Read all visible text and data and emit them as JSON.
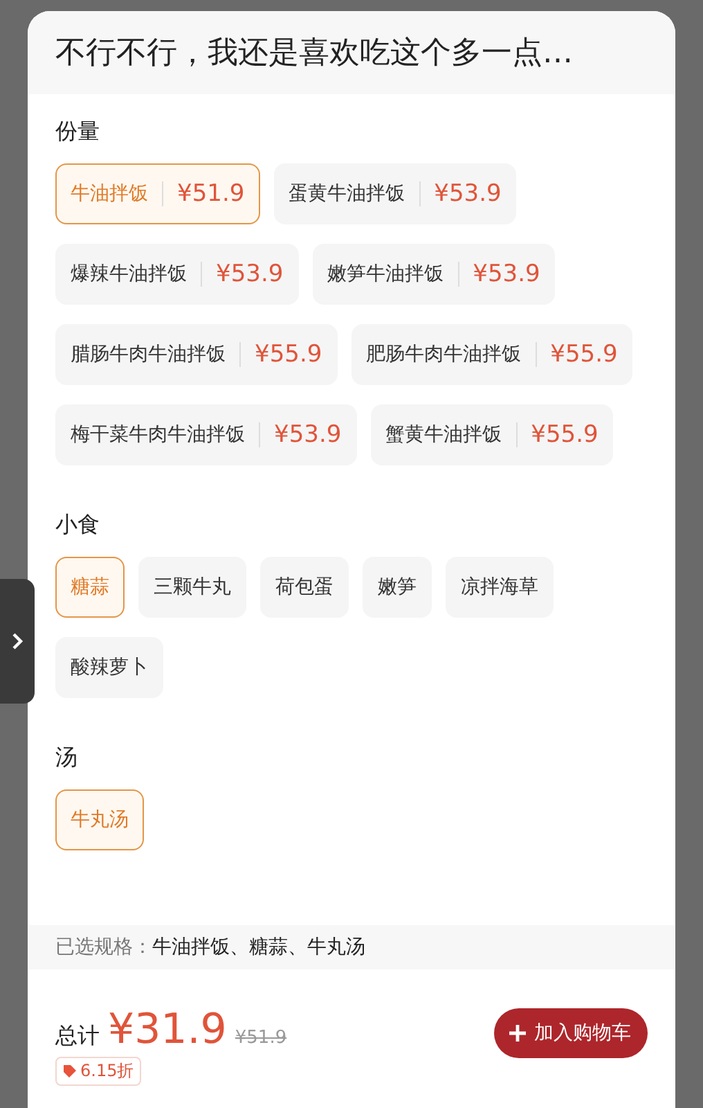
{
  "title": "不行不行，我还是喜欢吃这个多一点…",
  "sections": [
    {
      "label": "份量",
      "options": [
        {
          "label": "牛油拌饭",
          "price": "¥51.9",
          "selected": true
        },
        {
          "label": "蛋黄牛油拌饭",
          "price": "¥53.9",
          "selected": false
        },
        {
          "label": "爆辣牛油拌饭",
          "price": "¥53.9",
          "selected": false
        },
        {
          "label": "嫩笋牛油拌饭",
          "price": "¥53.9",
          "selected": false
        },
        {
          "label": "腊肠牛肉牛油拌饭",
          "price": "¥55.9",
          "selected": false
        },
        {
          "label": "肥肠牛肉牛油拌饭",
          "price": "¥55.9",
          "selected": false
        },
        {
          "label": "梅干菜牛肉牛油拌饭",
          "price": "¥53.9",
          "selected": false
        },
        {
          "label": "蟹黄牛油拌饭",
          "price": "¥55.9",
          "selected": false
        }
      ]
    },
    {
      "label": "小食",
      "options": [
        {
          "label": "糖蒜",
          "selected": true
        },
        {
          "label": "三颗牛丸",
          "selected": false
        },
        {
          "label": "荷包蛋",
          "selected": false
        },
        {
          "label": "嫩笋",
          "selected": false
        },
        {
          "label": "凉拌海草",
          "selected": false
        },
        {
          "label": "酸辣萝卜",
          "selected": false
        }
      ]
    },
    {
      "label": "汤",
      "options": [
        {
          "label": "牛丸汤",
          "selected": true
        }
      ]
    }
  ],
  "summary": {
    "label": "已选规格：",
    "value": "牛油拌饭、糖蒜、牛丸汤"
  },
  "total": {
    "label": "总计",
    "price": "¥31.9",
    "original_price": "¥51.9",
    "discount": "6.15折"
  },
  "add_button": {
    "label": "加入购物车"
  }
}
